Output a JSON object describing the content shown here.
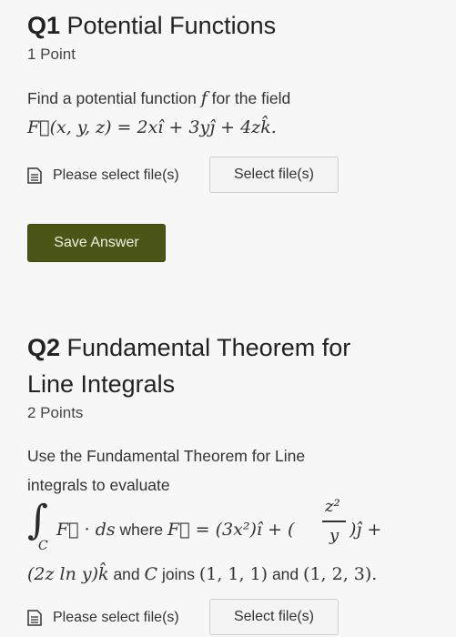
{
  "q1": {
    "number": "Q1",
    "title": "Potential Functions",
    "points": "1 Point",
    "prompt_text": "Find a potential function",
    "prompt_var": "f",
    "prompt_tail": "for the field",
    "field_expr": "F⃗(x, y, z) = 2xî + 3yĵ + 4zk̂.",
    "file_label": "Please select file(s)",
    "select_button": "Select file(s)",
    "save_button": "Save Answer"
  },
  "q2": {
    "number": "Q2",
    "title_line1": "Fundamental Theorem for",
    "title_line2": "Line Integrals",
    "points": "2 Points",
    "prompt_line1": "Use the Fundamental Theorem for Line",
    "prompt_line2": "integrals to evaluate",
    "integrand": "F⃗ · ds",
    "where_word": "where",
    "field_expr_a": "F⃗ = (3x²)î + (",
    "frac_num": "z²",
    "frac_den": "y",
    "field_expr_b": ")ĵ +",
    "line3_expr": "(2z ln y)k̂",
    "line3_and": "and",
    "curve": "C",
    "joins": "joins",
    "point1": "(1, 1, 1)",
    "point2": "(1, 2, 3).",
    "integral_sub": "C",
    "file_label": "Please select file(s)",
    "select_button": "Select file(s)"
  },
  "colors": {
    "save_button_bg": "#4b5517",
    "background": "#f7f7f7"
  },
  "icons": {
    "file": "document-icon"
  }
}
